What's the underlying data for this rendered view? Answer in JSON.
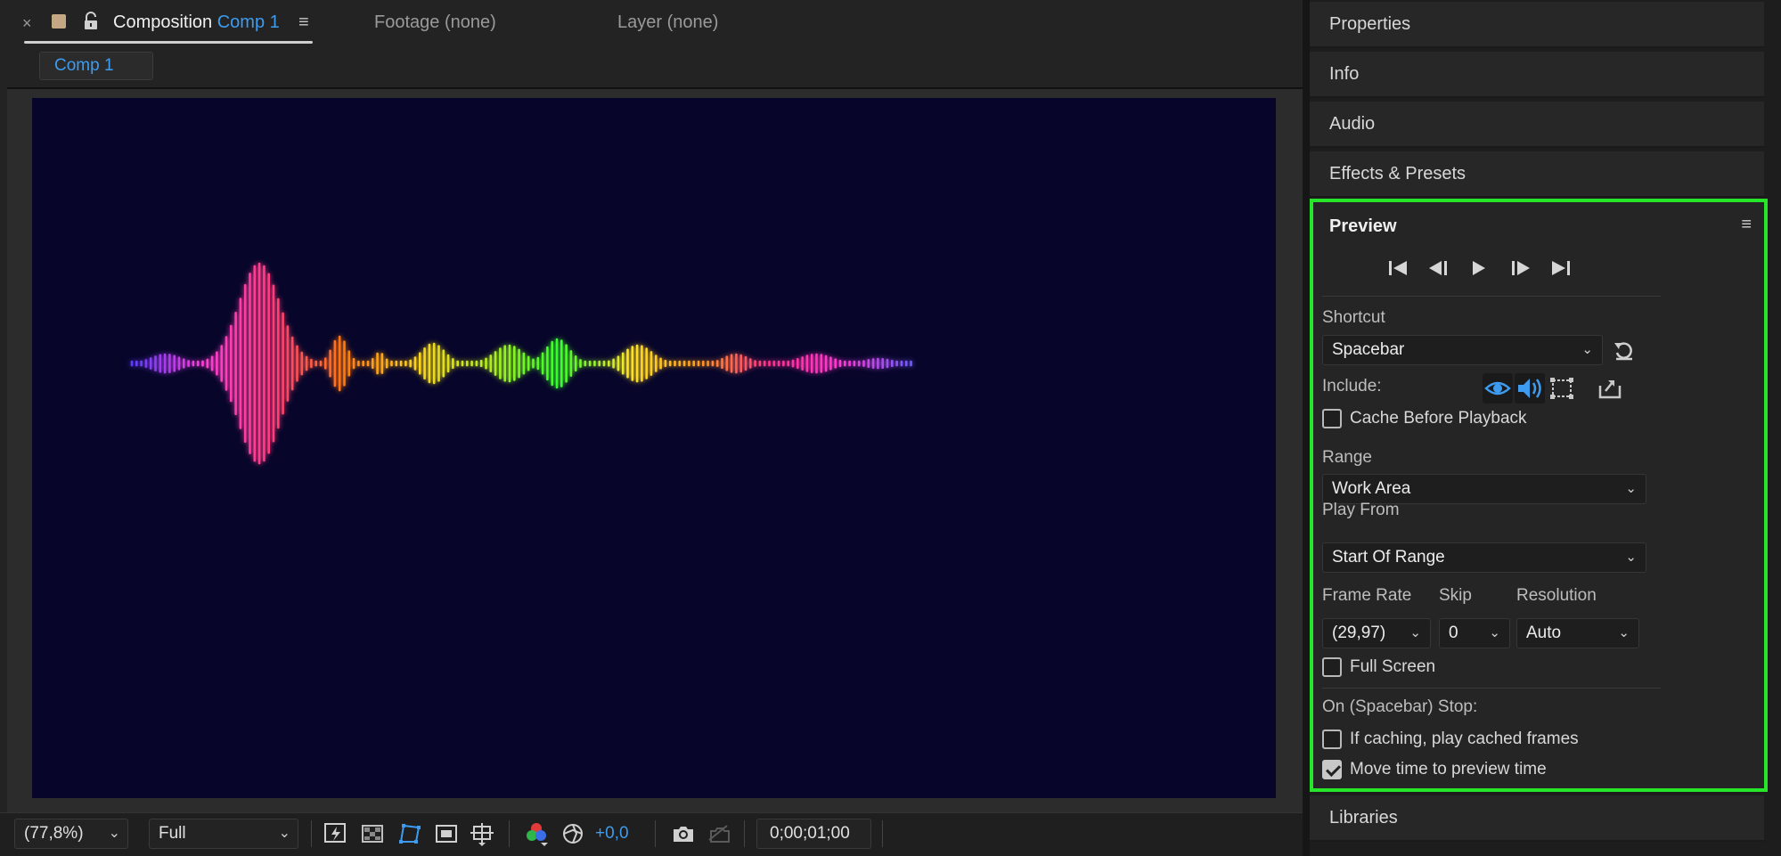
{
  "comp_panel": {
    "tab_main_prefix": "Composition",
    "tab_main_name": "Comp 1",
    "tab_footage": "Footage (none)",
    "tab_layer": "Layer (none)",
    "sub_tab": "Comp 1",
    "close_glyph": "×",
    "menu_glyph": "≡",
    "footer": {
      "zoom": "(77,8%)",
      "resolution": "Full",
      "exposure": "+0,0",
      "timecode": "0;00;01;00"
    }
  },
  "canvas": {
    "background": "#07052a",
    "wave_colors": [
      "#5b3cff",
      "#ff3fd8",
      "#ff3b7a",
      "#ff7a10",
      "#ffd41e",
      "#b7ef1e",
      "#35ff2a",
      "#ffe628",
      "#ff9a1a",
      "#ff2f8e",
      "#ff3ad4",
      "#6e5cff"
    ]
  },
  "right_panels": {
    "properties": "Properties",
    "info": "Info",
    "audio": "Audio",
    "effects": "Effects & Presets",
    "libraries": "Libraries"
  },
  "preview": {
    "title": "Preview",
    "menu_glyph": "≡",
    "shortcut_label": "Shortcut",
    "shortcut_value": "Spacebar",
    "include_label": "Include:",
    "cache_before_playback": {
      "label": "Cache Before Playback",
      "checked": false
    },
    "range_label": "Range",
    "range_value": "Work Area",
    "play_from_label": "Play From",
    "play_from_value": "Start Of Range",
    "frame_rate_label": "Frame Rate",
    "frame_rate_value": "(29,97)",
    "skip_label": "Skip",
    "skip_value": "0",
    "resolution_label": "Resolution",
    "resolution_value": "Auto",
    "full_screen": {
      "label": "Full Screen",
      "checked": false
    },
    "on_stop_label": "On (Spacebar) Stop:",
    "if_caching": {
      "label": "If caching, play cached frames",
      "checked": false
    },
    "move_time": {
      "label": "Move time to preview time",
      "checked": true
    },
    "highlight_color": "#27e62a",
    "accent_color": "#3d9cf0"
  }
}
